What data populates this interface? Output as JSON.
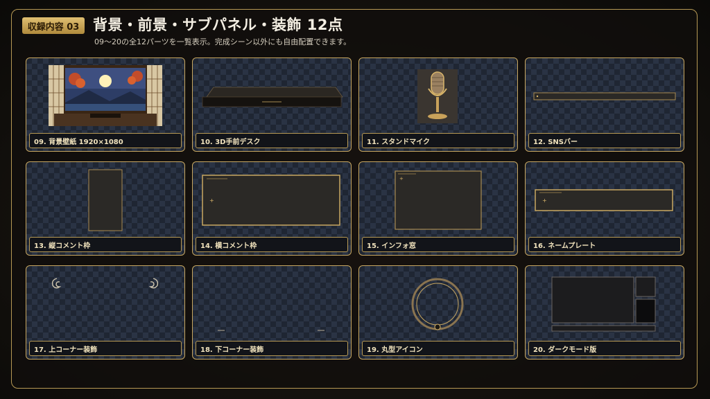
{
  "header": {
    "badge": "収録内容 03",
    "title": "背景・前景・サブパネル・装飾 12点",
    "subtitle": "09〜20の全12パーツを一覧表示。完成シーン以外にも自由配置できます。"
  },
  "colors": {
    "accent": "#c9a861",
    "badge": "#d4b263",
    "label_text": "#f1e3bd",
    "card_bg": "#1f2633"
  },
  "cards": [
    {
      "label": "09. 背景壁紙 1920×1080",
      "icon": "japanese-room-moon-icon"
    },
    {
      "label": "10. 3D手前デスク",
      "icon": "desk-icon"
    },
    {
      "label": "11. スタンドマイク",
      "icon": "microphone-icon"
    },
    {
      "label": "12. SNSバー",
      "icon": "sns-bar-icon"
    },
    {
      "label": "13. 縦コメント枠",
      "icon": "vertical-frame-icon"
    },
    {
      "label": "14. 横コメント枠",
      "icon": "horizontal-frame-icon"
    },
    {
      "label": "15. インフォ窓",
      "icon": "info-window-icon"
    },
    {
      "label": "16. ネームプレート",
      "icon": "nameplate-icon"
    },
    {
      "label": "17. 上コーナー装飾",
      "icon": "top-corner-ornament-icon"
    },
    {
      "label": "18. 下コーナー装飾",
      "icon": "bottom-corner-ornament-icon"
    },
    {
      "label": "19. 丸型アイコン",
      "icon": "round-icon-frame-icon"
    },
    {
      "label": "20. ダークモード版",
      "icon": "dark-mode-layout-icon"
    }
  ]
}
